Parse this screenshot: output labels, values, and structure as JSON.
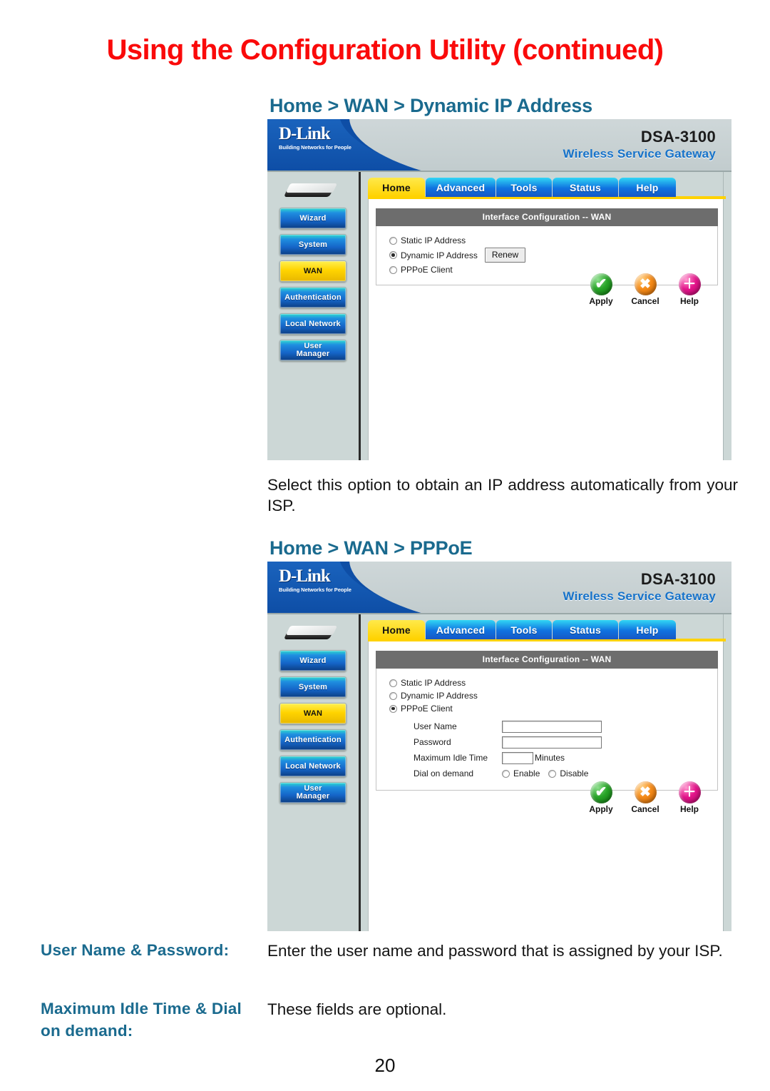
{
  "page": {
    "title": "Using the Configuration Utility (continued)",
    "number": "20",
    "title_color": "#fa0a0a",
    "heading_color": "#1a6a8e"
  },
  "sections": {
    "dynamic": {
      "heading": "Home > WAN > Dynamic IP Address",
      "description": "Select this option to obtain an IP address automatically from your ISP."
    },
    "pppoe": {
      "heading": "Home > WAN > PPPoE"
    }
  },
  "descriptions": [
    {
      "label": "User Name & Password:",
      "text": "Enter the user name and password that is assigned by your ISP."
    },
    {
      "label": "Maximum Idle Time & Dial on demand:",
      "text": "These fields are optional."
    }
  ],
  "router_ui": {
    "brand": "D-Link",
    "brand_tagline": "Building Networks for People",
    "model": "DSA-3100",
    "model_subtitle": "Wireless Service Gateway",
    "tabs": [
      {
        "label": "Home",
        "active": true
      },
      {
        "label": "Advanced",
        "active": false
      },
      {
        "label": "Tools",
        "active": false
      },
      {
        "label": "Status",
        "active": false
      },
      {
        "label": "Help",
        "active": false
      }
    ],
    "sidebar": [
      {
        "label": "Wizard",
        "active": false
      },
      {
        "label": "System",
        "active": false
      },
      {
        "label": "WAN",
        "active": true
      },
      {
        "label": "Authentication",
        "active": false
      },
      {
        "label": "Local Network",
        "active": false
      },
      {
        "label": "User\nManager",
        "active": false
      }
    ],
    "panel_title": "Interface Configuration -- WAN",
    "actions": [
      {
        "label": "Apply",
        "glyph": "✔",
        "color": "#28a428"
      },
      {
        "label": "Cancel",
        "glyph": "✖",
        "color": "#f48a18"
      },
      {
        "label": "Help",
        "glyph": "＋",
        "color": "#e3148a"
      }
    ]
  },
  "screen_dynamic": {
    "radios": [
      {
        "label": "Static IP Address",
        "checked": false
      },
      {
        "label": "Dynamic IP Address",
        "checked": true
      },
      {
        "label": "PPPoE Client",
        "checked": false
      }
    ],
    "renew_button": "Renew"
  },
  "screen_pppoe": {
    "radios": [
      {
        "label": "Static IP Address",
        "checked": false
      },
      {
        "label": "Dynamic IP Address",
        "checked": false
      },
      {
        "label": "PPPoE Client",
        "checked": true
      }
    ],
    "fields": [
      {
        "label": "User Name",
        "value": "",
        "type": "text"
      },
      {
        "label": "Password",
        "value": "",
        "type": "text"
      },
      {
        "label": "Maximum Idle Time",
        "value": "",
        "type": "small",
        "unit": "Minutes"
      }
    ],
    "dial_label": "Dial on demand",
    "dial_options": [
      {
        "label": "Enable",
        "checked": false
      },
      {
        "label": "Disable",
        "checked": false
      }
    ]
  }
}
